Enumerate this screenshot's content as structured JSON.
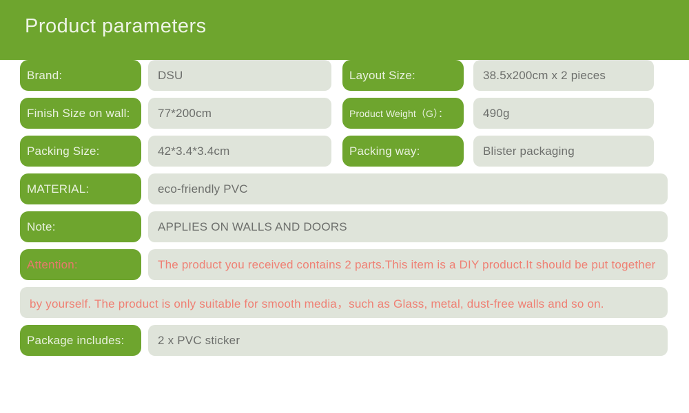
{
  "header": {
    "title": "Product parameters",
    "background_color": "#6ea52e",
    "text_color": "#eef4e6"
  },
  "colors": {
    "label_pill": "#6ea52e",
    "label_text": "#e9f1df",
    "value_field": "#dfe4da",
    "value_text": "#6d6f6c",
    "attention_text": "#ef8074"
  },
  "rows": [
    {
      "left": {
        "label": "Brand:",
        "value": "DSU"
      },
      "right": {
        "label": "Layout Size:",
        "value": "38.5x200cm x 2 pieces"
      }
    },
    {
      "left": {
        "label": "Finish Size on wall:",
        "value": "77*200cm"
      },
      "right": {
        "label": "Product Weight（G）：",
        "value": "490g"
      }
    },
    {
      "left": {
        "label": "Packing Size:",
        "value": "42*3.4*3.4cm"
      },
      "right": {
        "label": "Packing way:",
        "value": "Blister packaging"
      }
    }
  ],
  "full_rows": [
    {
      "label": "MATERIAL:",
      "value": "eco-friendly PVC"
    },
    {
      "label": "Note:",
      "value": "APPLIES ON WALLS AND DOORS"
    }
  ],
  "attention": {
    "label": "Attention:",
    "line1": "The product you received contains 2 parts.This item is a DIY product.It should be put together",
    "line2": "by yourself. The product is only suitable for smooth media，such as Glass, metal, dust-free walls and so on."
  },
  "package": {
    "label": "Package includes:",
    "value": "2 x PVC sticker"
  }
}
